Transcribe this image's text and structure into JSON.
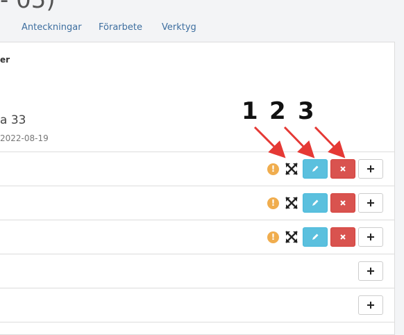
{
  "page": {
    "title_fragment": "- 05)"
  },
  "tabs": [
    {
      "label": "Anteckningar"
    },
    {
      "label": "Förarbete"
    },
    {
      "label": "Verktyg"
    }
  ],
  "panel": {
    "subheading": "er",
    "name": "a 33",
    "date": "2022-08-19"
  },
  "annotations": [
    {
      "label": "1"
    },
    {
      "label": "2"
    },
    {
      "label": "3"
    }
  ],
  "icons": {
    "warning": "!",
    "expand": "expand-icon",
    "edit": "pencil-icon",
    "delete": "x-icon",
    "add": "plus-icon"
  },
  "colors": {
    "warning": "#f0ad4e",
    "edit": "#5bc0de",
    "delete": "#d9534f",
    "arrow": "#e53935",
    "tab_text": "#3d6e9f"
  }
}
